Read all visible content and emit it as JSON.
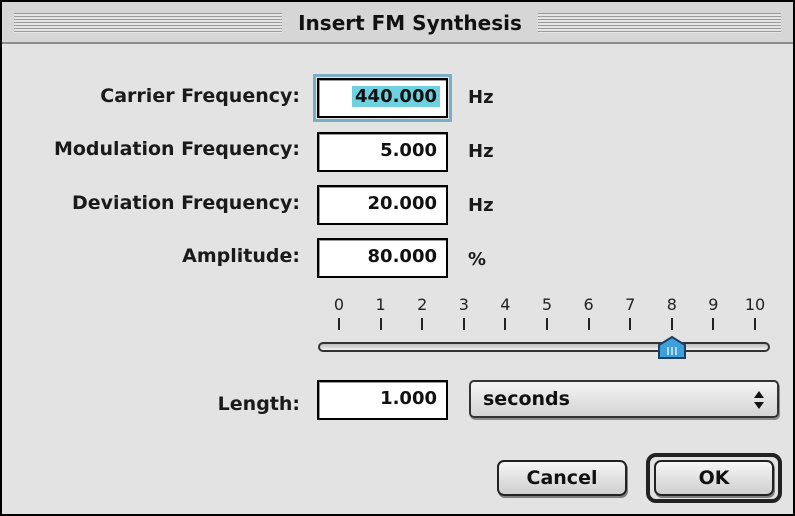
{
  "window": {
    "title": "Insert FM Synthesis"
  },
  "fields": {
    "carrier": {
      "label": "Carrier Frequency:",
      "value": "440.000",
      "unit": "Hz"
    },
    "modulation": {
      "label": "Modulation Frequency:",
      "value": "5.000",
      "unit": "Hz"
    },
    "deviation": {
      "label": "Deviation Frequency:",
      "value": "20.000",
      "unit": "Hz"
    },
    "amplitude": {
      "label": "Amplitude:",
      "value": "80.000",
      "unit": "%"
    }
  },
  "slider": {
    "tick_labels": [
      "0",
      "1",
      "2",
      "3",
      "4",
      "5",
      "6",
      "7",
      "8",
      "9",
      "10"
    ],
    "value": 8,
    "min": 0,
    "max": 10
  },
  "length": {
    "label": "Length:",
    "value": "1.000",
    "unit_selected": "seconds"
  },
  "buttons": {
    "cancel": "Cancel",
    "ok": "OK"
  },
  "colors": {
    "selection_highlight": "#6fd0e0",
    "slider_thumb": "#3f9fd8"
  },
  "icons": {
    "popup_arrows": "up-down-arrows-icon",
    "slider_thumb": "slider-thumb-icon"
  }
}
